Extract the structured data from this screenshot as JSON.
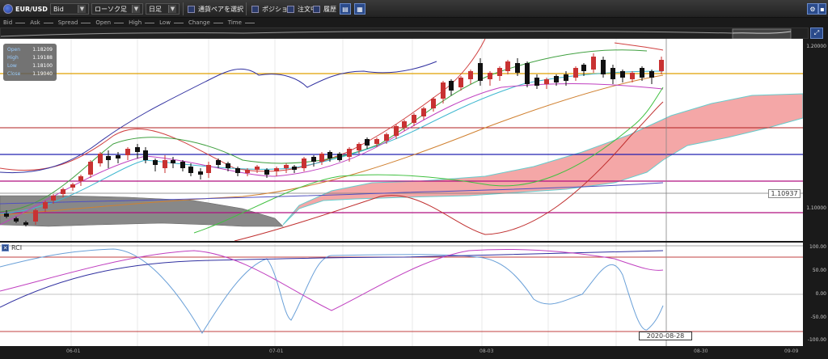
{
  "toolbar": {
    "pair": "EUR/USD",
    "price_type": "Bid",
    "chart_type": "ローソク足",
    "timeframe": "日足",
    "select_pair_label": "通貨ペアを選択",
    "position_label": "ポジション",
    "order_label": "注文中",
    "history_label": "履歴"
  },
  "legend": {
    "items": [
      "Bid",
      "Ask",
      "Spread",
      "Open",
      "High",
      "Low",
      "Change",
      "Time"
    ]
  },
  "ohlc": {
    "open_label": "Open",
    "open": "1.18209",
    "high_label": "High",
    "high": "1.19188",
    "low_label": "Low",
    "low": "1.18100",
    "close_label": "Close",
    "close": "1.19040"
  },
  "main_axis": {
    "labels": [
      "1.20000",
      "1.10000"
    ]
  },
  "price_tag": "1.10937",
  "rci": {
    "label": "RCI",
    "axis_labels": [
      "100.00",
      "50.00",
      "0.00",
      "-50.00",
      "-100.00"
    ]
  },
  "date_tag": "2020-08-28",
  "x_axis": {
    "labels": [
      "06-01",
      "07-01",
      "08-03",
      "08-30",
      "09-09"
    ]
  },
  "colors": {
    "bull": "#c83232",
    "bear": "#111111",
    "cloud": "#f4a7a7",
    "cloud_old": "#888888"
  }
}
